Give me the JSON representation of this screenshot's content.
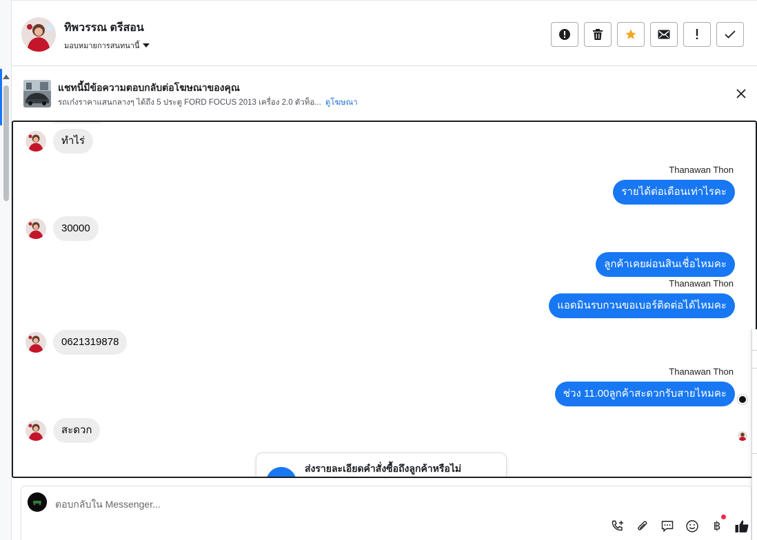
{
  "header": {
    "contact_name": "ทิพวรรณ ตรีสอน",
    "assign_label": "มอบหมายการสนทนานี้",
    "actions": [
      {
        "icon": "alert-circle-icon",
        "label": "mark-spam"
      },
      {
        "icon": "trash-icon",
        "label": "delete"
      },
      {
        "icon": "star-icon",
        "label": "star"
      },
      {
        "icon": "envelope-icon",
        "label": "mark-unread"
      },
      {
        "icon": "exclamation-icon",
        "label": "follow-up"
      },
      {
        "icon": "check-icon",
        "label": "mark-done"
      }
    ]
  },
  "ad": {
    "title": "แชทนี้มีข้อความตอบกลับต่อโฆษณาของคุณ",
    "description": "รถเก๋งราคาแสนกลางๆ ได้ถึง 5 ประตู FORD FOCUS 2013 เครื่อง 2.0 ตัวท็อ...",
    "link": "ดูโฆษณา"
  },
  "messages": [
    {
      "direction": "in",
      "text": "ทำไร่"
    },
    {
      "direction": "out",
      "sender": "Thanawan Thon",
      "text": "รายได้ต่อเดือนเท่าไรคะ"
    },
    {
      "direction": "in",
      "text": "30000"
    },
    {
      "direction": "out",
      "sender": "",
      "text": "ลูกค้าเคยผ่อนสินเชื่อไหมคะ"
    },
    {
      "direction": "out",
      "sender": "Thanawan Thon",
      "text": "แอดมินรบกวนขอเบอร์ติดต่อได้ไหมคะ"
    },
    {
      "direction": "in",
      "text": "0621319878"
    },
    {
      "direction": "out",
      "sender": "Thanawan Thon",
      "text": "ช่วง 11.00ลูกค้าสะดวกรับสายไหมคะ"
    },
    {
      "direction": "in",
      "text": "สะดวก"
    }
  ],
  "suggestion": {
    "text": "ส่งรายละเอียดคำสั่งซื้อถึงลูกค้าหรือไม่"
  },
  "composer": {
    "placeholder": "ตอบกลับใน Messenger...",
    "tools": [
      "phone-plus-icon",
      "paperclip-icon",
      "saved-reply-icon",
      "emoji-icon",
      "baht-icon",
      "thumbs-up-icon"
    ]
  },
  "colors": {
    "accent": "#1877f2",
    "incoming_bubble": "#ededed",
    "star": "#f5a623",
    "notification": "#f02849"
  }
}
